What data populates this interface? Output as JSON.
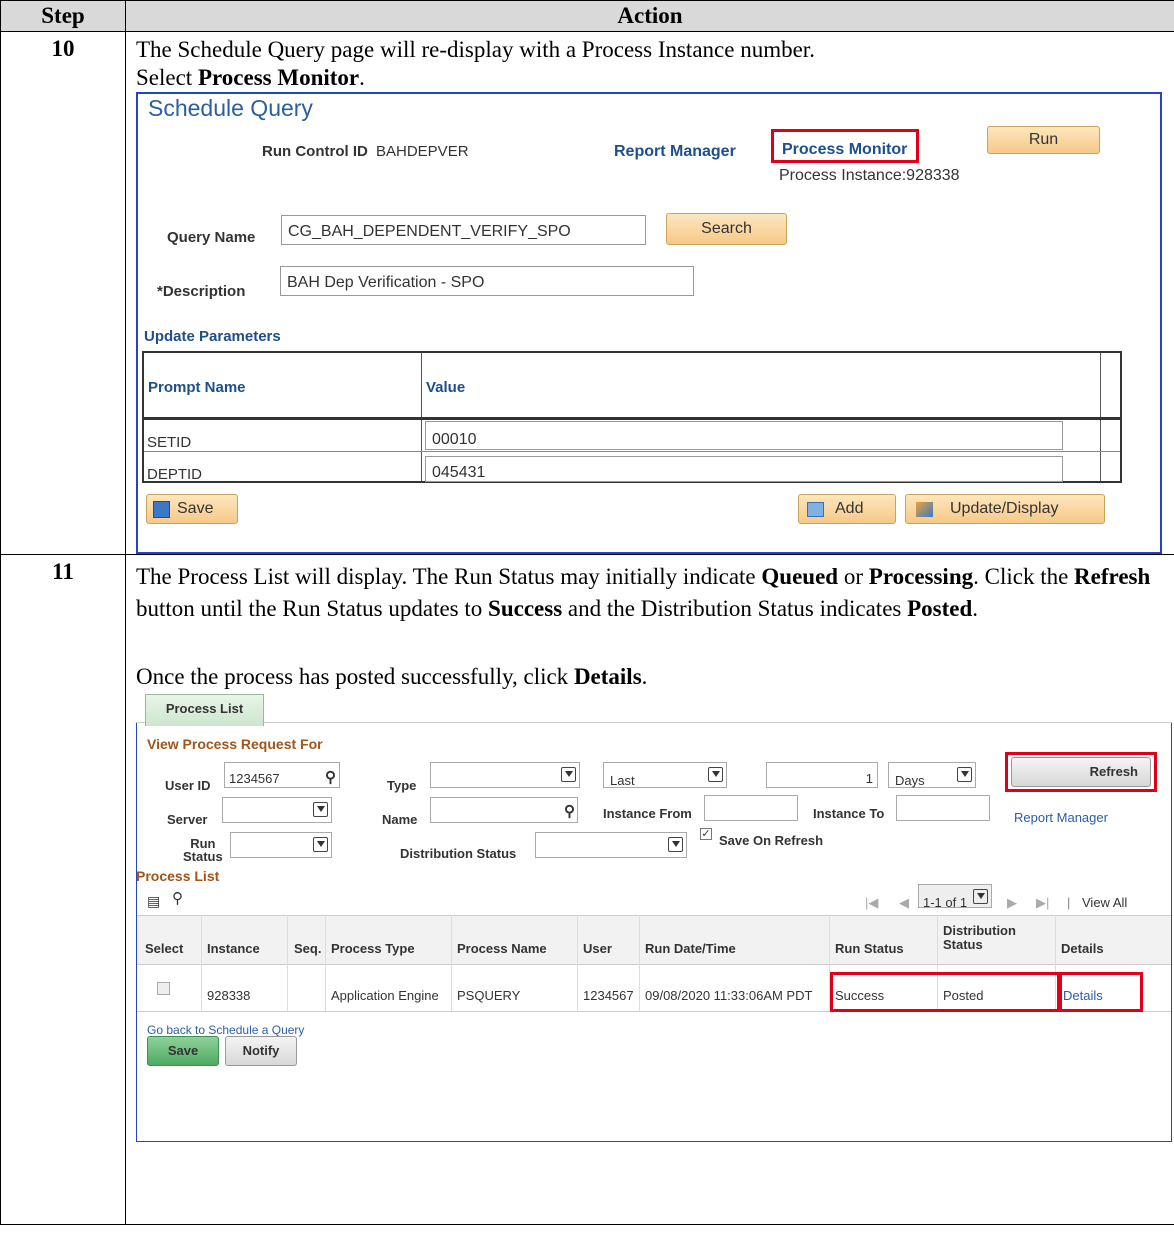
{
  "header": {
    "step": "Step",
    "action": "Action"
  },
  "step10": {
    "num": "10",
    "text1": "The Schedule Query page will re-display with a Process Instance number.",
    "text2_pre": "Select ",
    "text2_bold": "Process Monitor",
    "text2_post": ".",
    "sq": {
      "title": "Schedule Query",
      "run_control_label": "Run Control ID",
      "run_control_value": "BAHDEPVER",
      "report_manager": "Report Manager",
      "process_monitor": "Process Monitor",
      "run_button": "Run",
      "process_instance": "Process Instance:928338",
      "query_name_label": "Query Name",
      "query_name_value": "CG_BAH_DEPENDENT_VERIFY_SPO",
      "search_button": "Search",
      "description_label": "*Description",
      "description_value": "BAH Dep Verification - SPO",
      "update_parameters": "Update Parameters",
      "col_prompt": "Prompt Name",
      "col_value": "Value",
      "rows": [
        {
          "name": "SETID",
          "value": "00010"
        },
        {
          "name": "DEPTID",
          "value": "045431"
        }
      ],
      "save_button": "Save",
      "add_button": "Add",
      "update_display_button": "Update/Display"
    }
  },
  "step11": {
    "num": "11",
    "p1_a": "The Process List will display.  The Run Status may initially indicate ",
    "p1_b": "Queued",
    "p1_c": " or ",
    "p1_d": "Processing",
    "p1_e": ". Click the ",
    "p1_f": "Refresh",
    "p1_g": " button until the Run Status updates to ",
    "p1_h": "Success",
    "p1_i": " and the Distribution Status indicates ",
    "p1_j": "Posted",
    "p1_k": ".",
    "p2_a": "Once the process has posted successfully, click ",
    "p2_b": "Details",
    "p2_c": ".",
    "pl": {
      "tab": "Process List",
      "view_for": "View Process Request For",
      "user_id_label": "User ID",
      "user_id_value": "1234567",
      "type_label": "Type",
      "last_value": "Last",
      "number_value": "1",
      "days_value": "Days",
      "refresh_button": "Refresh",
      "server_label": "Server",
      "name_label": "Name",
      "instance_from_label": "Instance From",
      "instance_to_label": "Instance To",
      "report_manager": "Report Manager",
      "run_status_label1": "Run",
      "run_status_label2": "Status",
      "distribution_status_label": "Distribution Status",
      "save_on_refresh": "Save On Refresh",
      "process_list_heading": "Process List",
      "pager": "1-1 of 1",
      "view_all": "View All",
      "columns": [
        "Select",
        "Instance",
        "Seq.",
        "Process Type",
        "Process Name",
        "User",
        "Run Date/Time",
        "Run Status",
        "Distribution Status",
        "Details"
      ],
      "row": {
        "instance": "928338",
        "seq": "",
        "process_type": "Application Engine",
        "process_name": "PSQUERY",
        "user": "1234567",
        "run_datetime": "09/08/2020 11:33:06AM PDT",
        "run_status": "Success",
        "dist_status": "Posted",
        "details": "Details"
      },
      "go_back": "Go back to Schedule a Query",
      "save_button": "Save",
      "notify_button": "Notify"
    }
  }
}
